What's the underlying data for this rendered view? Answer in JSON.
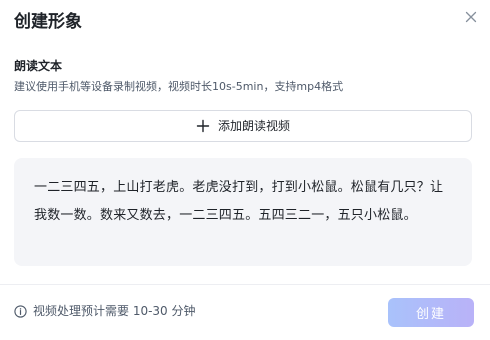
{
  "dialog": {
    "title": "创建形象",
    "close_icon": "close-icon"
  },
  "section": {
    "label": "朗读文本",
    "description": "建议使用手机等设备录制视频，视频时长10s-5min，支持mp4格式"
  },
  "add_video": {
    "icon": "plus-icon",
    "label": "添加朗读视频"
  },
  "script": {
    "text": "一二三四五，上山打老虎。老虎没打到，打到小松鼠。松鼠有几只？让我数一数。数来又数去，一二三四五。五四三二一，五只小松鼠。"
  },
  "footer": {
    "info_icon": "info-icon",
    "note": "视频处理预计需要 10-30 分钟",
    "create_label": "创建",
    "create_enabled": false
  },
  "colors": {
    "create_button_gradient_start": "#a9c2fb",
    "create_button_gradient_end": "#b9b2f8",
    "script_background": "#f4f5f8"
  }
}
